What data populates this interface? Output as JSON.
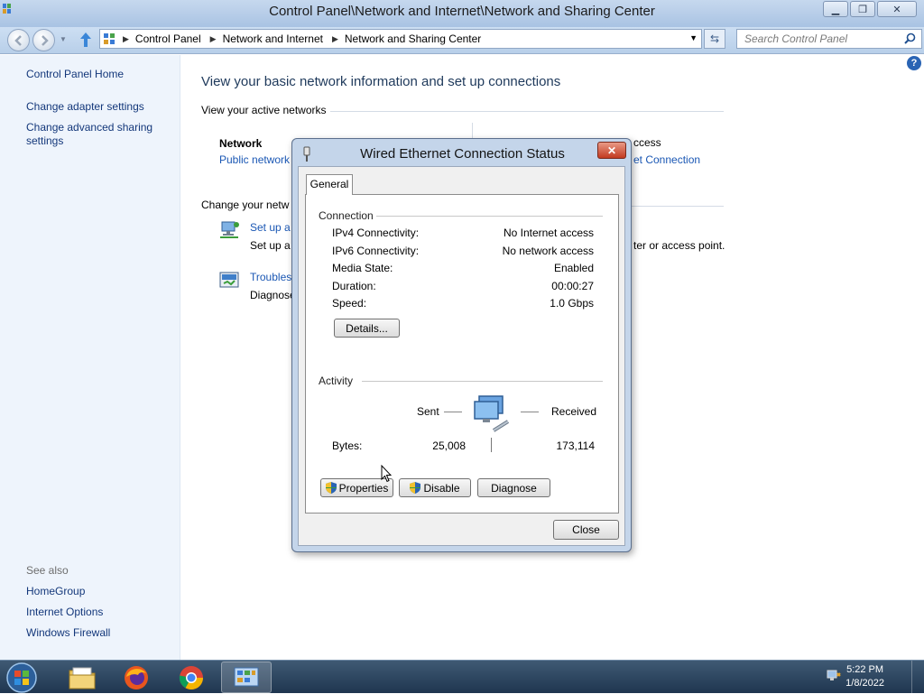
{
  "window": {
    "title": "Control Panel\\Network and Internet\\Network and Sharing Center",
    "buttons": {
      "minimize": "minimize-icon",
      "maximize": "maximize-icon",
      "close": "close-icon"
    }
  },
  "addressbar": {
    "breadcrumbs": [
      "Control Panel",
      "Network and Internet",
      "Network and Sharing Center"
    ],
    "search_placeholder": "Search Control Panel"
  },
  "sidebar": {
    "items": [
      {
        "label": "Control Panel Home"
      },
      {
        "label": "Change adapter settings"
      },
      {
        "label": "Change advanced sharing settings"
      }
    ],
    "see_also_label": "See also",
    "see_also": [
      {
        "label": "HomeGroup"
      },
      {
        "label": "Internet Options"
      },
      {
        "label": "Windows Firewall"
      }
    ]
  },
  "main": {
    "heading": "View your basic network information and set up connections",
    "active_networks_label": "View your active networks",
    "network_name": "Network",
    "network_type": "Public network",
    "access_type_fragment": "ccess",
    "connection_fragment": "et Connection",
    "change_settings_label": "Change your netw",
    "setup_link": "Set up a",
    "setup_desc": "Set up a",
    "setup_desc_tail": "ter or access point.",
    "trouble_link": "Troubles",
    "trouble_desc": "Diagnose"
  },
  "dialog": {
    "title": "Wired Ethernet Connection Status",
    "close_icon": "close-icon",
    "tab": "General",
    "connection_group": "Connection",
    "rows": [
      {
        "label": "IPv4 Connectivity:",
        "value": "No Internet access"
      },
      {
        "label": "IPv6 Connectivity:",
        "value": "No network access"
      },
      {
        "label": "Media State:",
        "value": "Enabled"
      },
      {
        "label": "Duration:",
        "value": "00:00:27"
      },
      {
        "label": "Speed:",
        "value": "1.0 Gbps"
      }
    ],
    "details_button": "Details...",
    "activity_group": "Activity",
    "sent_label": "Sent",
    "received_label": "Received",
    "bytes_label": "Bytes:",
    "bytes_sent": "25,008",
    "bytes_received": "173,114",
    "properties_button": "Properties",
    "disable_button": "Disable",
    "diagnose_button": "Diagnose",
    "close_button": "Close"
  },
  "taskbar": {
    "time": "5:22 PM",
    "date": "1/8/2022",
    "apps": [
      "explorer-icon",
      "firefox-icon",
      "chrome-icon",
      "control-panel-icon"
    ]
  }
}
